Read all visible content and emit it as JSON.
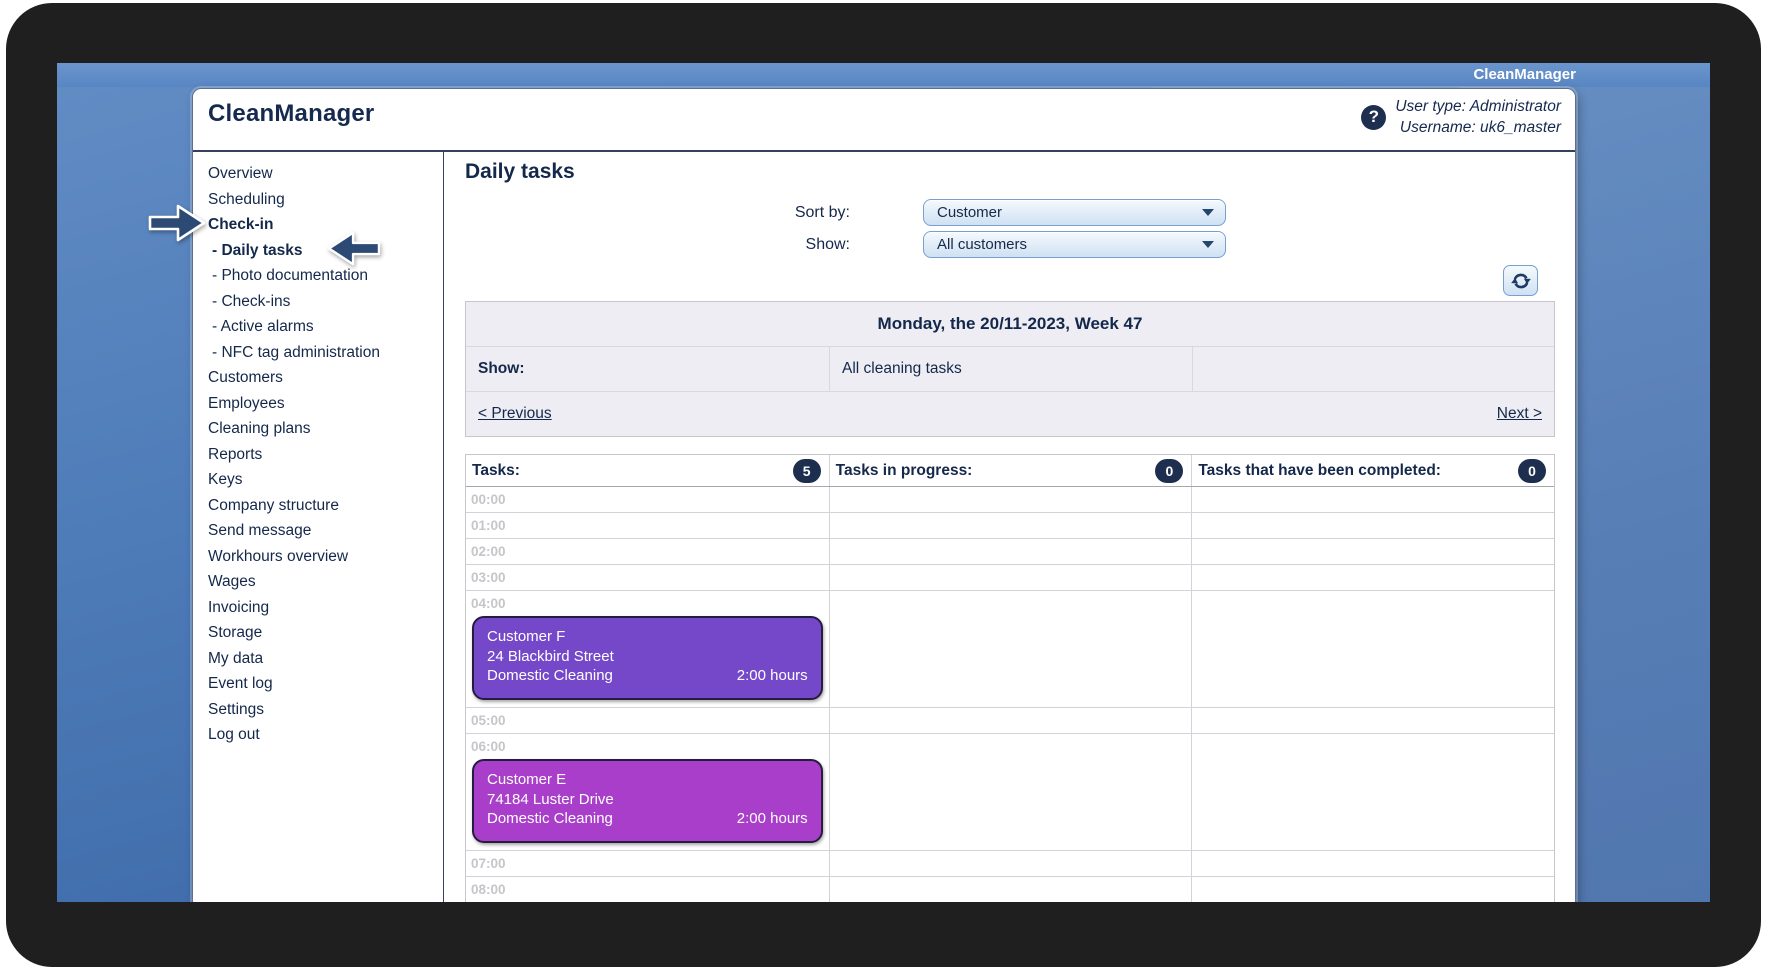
{
  "titlebar": {
    "brand": "CleanManager"
  },
  "header": {
    "logo": "CleanManager",
    "help_icon": "?",
    "user_type": "User type: Administrator",
    "username": "Username: uk6_master"
  },
  "sidebar": {
    "items": [
      {
        "label": "Overview"
      },
      {
        "label": "Scheduling"
      },
      {
        "label": "Check-in",
        "bold": true
      },
      {
        "label": "- Daily tasks",
        "bold": true,
        "sub": true
      },
      {
        "label": "- Photo documentation",
        "sub": true
      },
      {
        "label": "- Check-ins",
        "sub": true
      },
      {
        "label": "- Active alarms",
        "sub": true
      },
      {
        "label": "- NFC tag administration",
        "sub": true
      },
      {
        "label": "Customers"
      },
      {
        "label": "Employees"
      },
      {
        "label": "Cleaning plans"
      },
      {
        "label": "Reports"
      },
      {
        "label": "Keys"
      },
      {
        "label": "Company structure"
      },
      {
        "label": "Send message"
      },
      {
        "label": "Workhours overview"
      },
      {
        "label": "Wages"
      },
      {
        "label": "Invoicing"
      },
      {
        "label": "Storage"
      },
      {
        "label": "My data"
      },
      {
        "label": "Event log"
      },
      {
        "label": "Settings"
      },
      {
        "label": "Log out"
      }
    ]
  },
  "annotations": {
    "arrows": [
      {
        "target": "Check-in",
        "direction": "right"
      },
      {
        "target": "- Daily tasks",
        "direction": "left"
      }
    ]
  },
  "main": {
    "title": "Daily tasks",
    "controls": {
      "sort_label": "Sort by:",
      "sort_value": "Customer",
      "show_label": "Show:",
      "show_value": "All customers"
    },
    "date_bar": {
      "date_title": "Monday, the 20/11-2023, Week 47",
      "show_label": "Show:",
      "show_value": "All cleaning tasks",
      "prev_link": "< Previous",
      "next_link": "Next >"
    },
    "board": {
      "columns": [
        {
          "label": "Tasks:",
          "count": "5"
        },
        {
          "label": "Tasks in progress:",
          "count": "0"
        },
        {
          "label": "Tasks that have been completed:",
          "count": "0"
        }
      ],
      "hours": [
        "00:00",
        "01:00",
        "02:00",
        "03:00",
        "04:00",
        "05:00",
        "06:00",
        "07:00",
        "08:00"
      ],
      "tasks": [
        {
          "hour": "04:00",
          "customer": "Customer F",
          "address": "24 Blackbird Street",
          "service": "Domestic Cleaning",
          "duration": "2:00 hours",
          "color": "#7448c9"
        },
        {
          "hour": "06:00",
          "customer": "Customer E",
          "address": "74184 Luster Drive",
          "service": "Domestic Cleaning",
          "duration": "2:00 hours",
          "color": "#a83ec9"
        }
      ]
    }
  },
  "colors": {
    "text_navy": "#14284b",
    "badge_navy": "#1d2e4e",
    "titlebar_blue": "#5d8cc8",
    "desktop_blue": "#4573b0",
    "task_purple": "#7448c9",
    "task_magenta": "#a83ec9"
  }
}
